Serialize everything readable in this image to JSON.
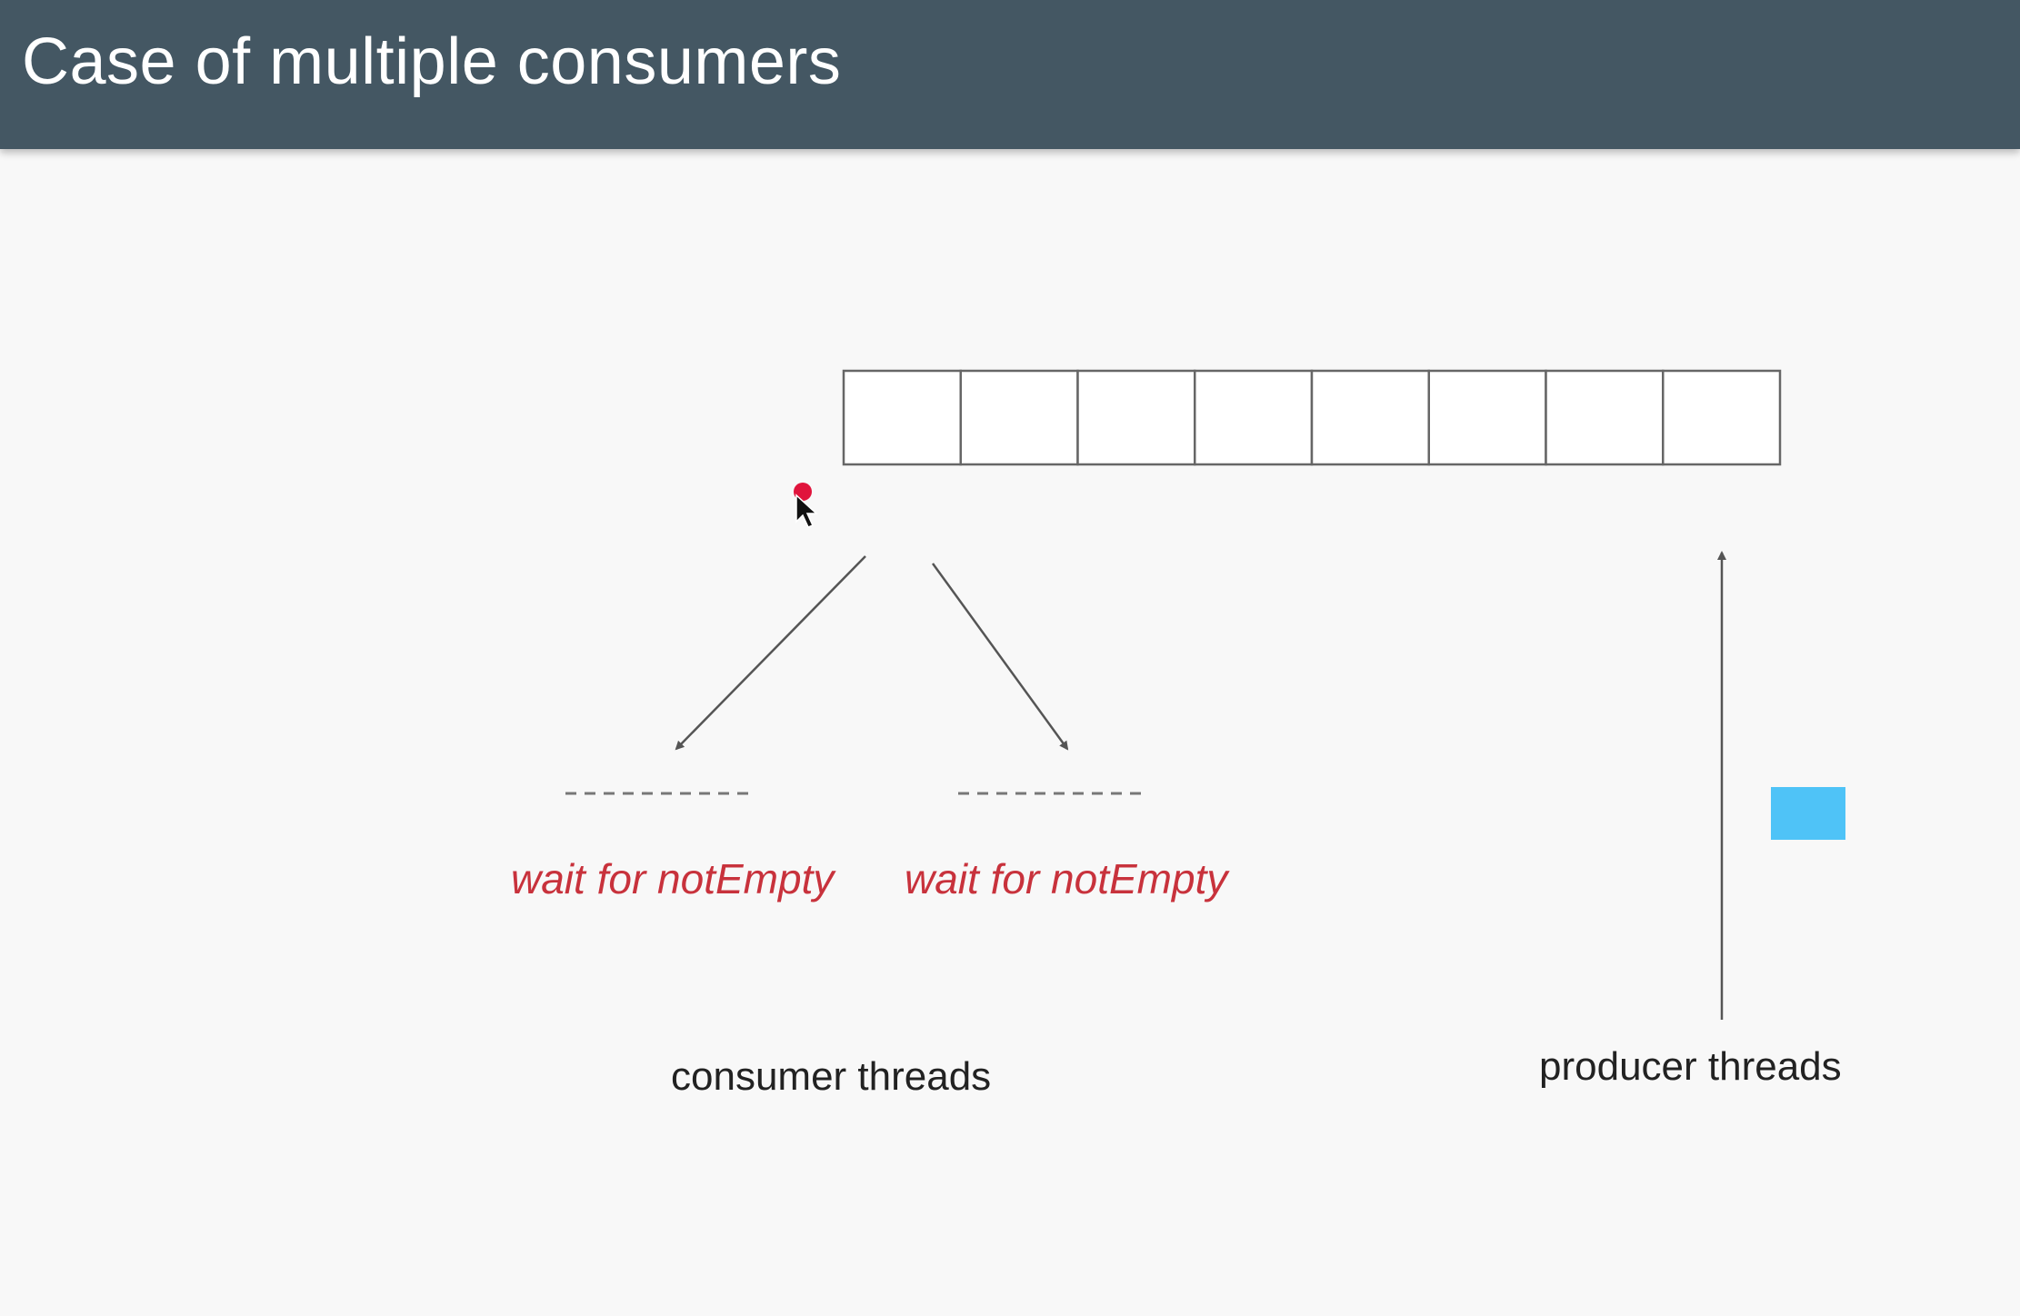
{
  "slide": {
    "title": "Case of multiple consumers"
  },
  "queue": {
    "slot_count": 8
  },
  "consumers": [
    {
      "status": "wait for notEmpty"
    },
    {
      "status": "wait for notEmpty"
    }
  ],
  "labels": {
    "consumer": "consumer threads",
    "producer": "producer threads"
  },
  "colors": {
    "header_bg": "#445763",
    "wait_text": "#c8323c",
    "item": "#4fc3f7",
    "pointer_dot": "#e0143c"
  },
  "icons": {
    "pointer": "mouse-cursor-icon",
    "laser": "laser-pointer-dot"
  }
}
